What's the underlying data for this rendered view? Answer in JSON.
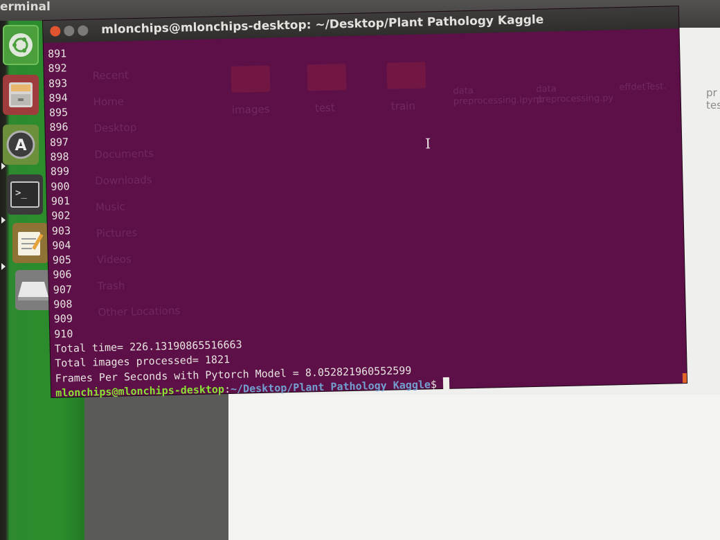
{
  "top_panel": {
    "app_name": "erminal"
  },
  "launcher": {
    "items": [
      {
        "name": "ubuntu-dash",
        "icon": "ubuntu-logo-icon"
      },
      {
        "name": "files",
        "icon": "file-cabinet-icon"
      },
      {
        "name": "software-updater",
        "icon": "updater-icon"
      },
      {
        "name": "terminal",
        "icon": "terminal-icon"
      },
      {
        "name": "text-editor",
        "icon": "notepad-icon"
      },
      {
        "name": "drive",
        "icon": "drive-icon"
      }
    ]
  },
  "terminal": {
    "title": "mlonchips@mlonchips-desktop: ~/Desktop/Plant Pathology Kaggle",
    "line_numbers": [
      "891",
      "892",
      "893",
      "894",
      "895",
      "896",
      "897",
      "898",
      "899",
      "900",
      "901",
      "902",
      "903",
      "904",
      "905",
      "906",
      "907",
      "908",
      "909",
      "910"
    ],
    "output": [
      "Total time= 226.13190865516663",
      "Total images processed= 1821",
      "Frames Per Seconds with Pytorch Model = 8.052821960552599"
    ],
    "prompt_user": "mlonchips@mlonchips-desktop",
    "prompt_sep": ":",
    "prompt_path": "~/Desktop/Plant Pathology Kaggle",
    "prompt_symbol": "$ "
  },
  "background_window": {
    "folders": [
      "images",
      "test",
      "train",
      "data preprocessing.ipynb",
      "data preprocessing.py",
      "effdetTest.",
      "pr tes"
    ],
    "sidebar": [
      "Recent",
      "Home",
      "Desktop",
      "Documents",
      "Downloads",
      "Music",
      "Pictures",
      "Videos",
      "Trash",
      "Other Locations"
    ]
  },
  "colors": {
    "terminal_bg": "#5d1048",
    "prompt_user": "#8ae234",
    "prompt_path": "#729fcf",
    "launcher": "#2b8c2b"
  }
}
